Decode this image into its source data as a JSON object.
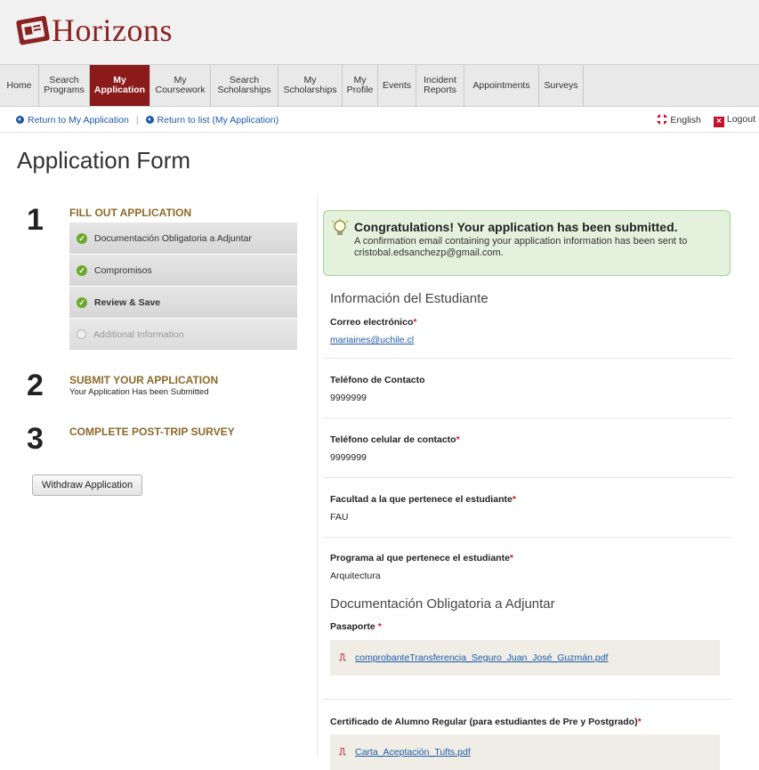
{
  "app": {
    "logo_text": "Horizons"
  },
  "nav": {
    "items": [
      {
        "label": "Home",
        "active": false
      },
      {
        "label": "Search Programs",
        "active": false
      },
      {
        "label": "My Application",
        "active": true
      },
      {
        "label": "My Coursework",
        "active": false
      },
      {
        "label": "Search Scholarships",
        "active": false
      },
      {
        "label": "My Scholarships",
        "active": false
      },
      {
        "label": "My Profile",
        "active": false
      },
      {
        "label": "Events",
        "active": false
      },
      {
        "label": "Incident Reports",
        "active": false
      },
      {
        "label": "Appointments",
        "active": false
      },
      {
        "label": "Surveys",
        "active": false
      }
    ]
  },
  "subbar": {
    "return_app": "Return to My Application",
    "return_list": "Return to list (My Application)",
    "language": "English",
    "logout": "Logout"
  },
  "page": {
    "title": "Application Form"
  },
  "steps": {
    "s1": {
      "num": "1",
      "title": "FILL OUT APPLICATION",
      "items": [
        {
          "label": "Documentación Obligatoria a Adjuntar",
          "status": "complete"
        },
        {
          "label": "Compromisos",
          "status": "complete"
        },
        {
          "label": "Review & Save",
          "status": "complete"
        },
        {
          "label": "Additional Information",
          "status": "pending"
        }
      ]
    },
    "s2": {
      "num": "2",
      "title": "SUBMIT YOUR APPLICATION",
      "sub": "Your Application Has been Submitted"
    },
    "s3": {
      "num": "3",
      "title": "COMPLETE POST-TRIP SURVEY"
    }
  },
  "withdraw_label": "Withdraw Application",
  "notice": {
    "title": "Congratulations! Your application has been submitted.",
    "body": "A confirmation email containing your application information has been sent to cristobal.edsanchezp@gmail.com."
  },
  "student": {
    "heading": "Información del Estudiante",
    "email_label": "Correo electrónico",
    "email_value": "mariaines@uchile.cl",
    "phone_label": "Teléfono de Contacto",
    "phone_value": "9999999",
    "cell_label": "Teléfono celular de contacto",
    "cell_value": "9999999",
    "faculty_label": "Facultad a la que pertenece el estudiante",
    "faculty_value": "FAU",
    "program_label": "Programa al que pertenece el estudiante",
    "program_value": "Arquitectura"
  },
  "docs": {
    "heading": "Documentación Obligatoria a Adjuntar",
    "passport_label": "Pasaporte",
    "passport_file": "comprobanteTransferencia_Seguro_Juan_José_Guzmán.pdf",
    "cert_label": "Certificado de Alumno Regular (para estudiantes de Pre y Postgrado)",
    "cert_file": "Carta_Aceptación_Tufts.pdf"
  },
  "required_mark": "*",
  "colors": {
    "brand": "#8b1a1a",
    "link": "#1e5aa8",
    "success_bg": "#e4f1dc",
    "step_title": "#8b6a2a"
  }
}
